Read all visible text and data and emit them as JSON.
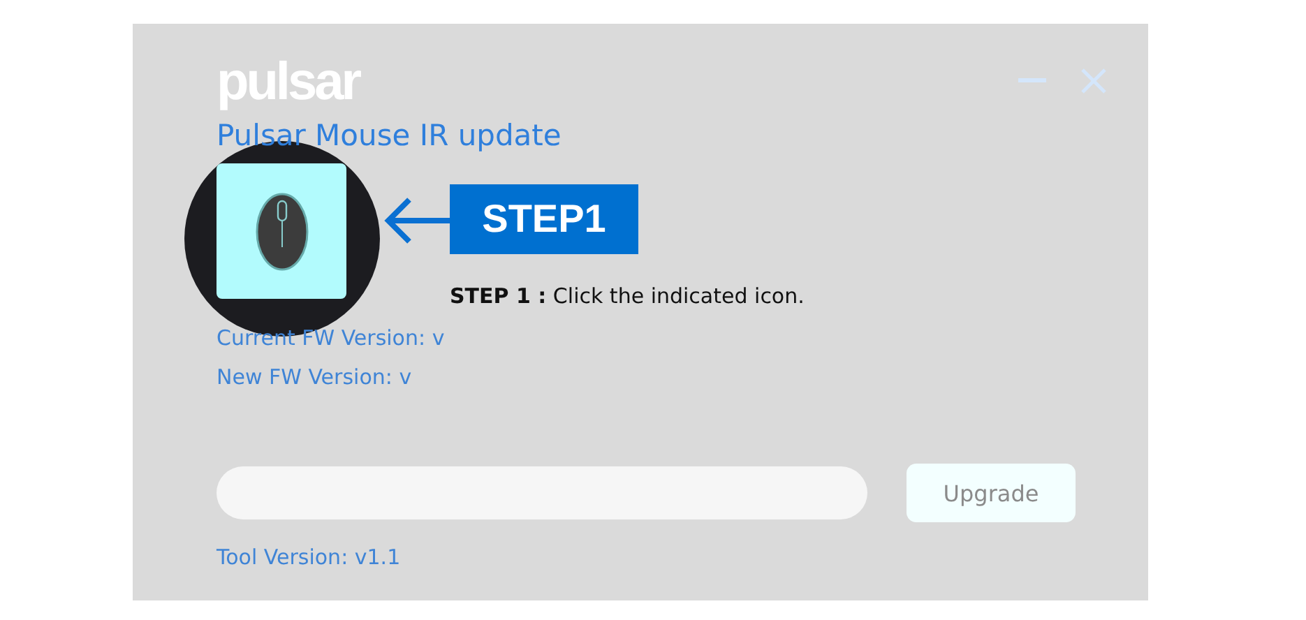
{
  "window": {
    "logo": "pulsar",
    "title": "Pulsar Mouse IR update",
    "controls": [
      {
        "kind": "minimize"
      },
      {
        "kind": "close"
      }
    ]
  },
  "device": {
    "kind": "mouse"
  },
  "versions": [
    "Current FW Version:  v",
    "New FW Version:  v"
  ],
  "progress": {
    "level": 0
  },
  "upgrade_button": {
    "label": "Upgrade",
    "disabled": true
  },
  "tool_version": "Tool Version:  v1.1",
  "guide": {
    "badge": "STEP1",
    "instruction": "**STEP 1 :** Click the indicated icon."
  }
}
